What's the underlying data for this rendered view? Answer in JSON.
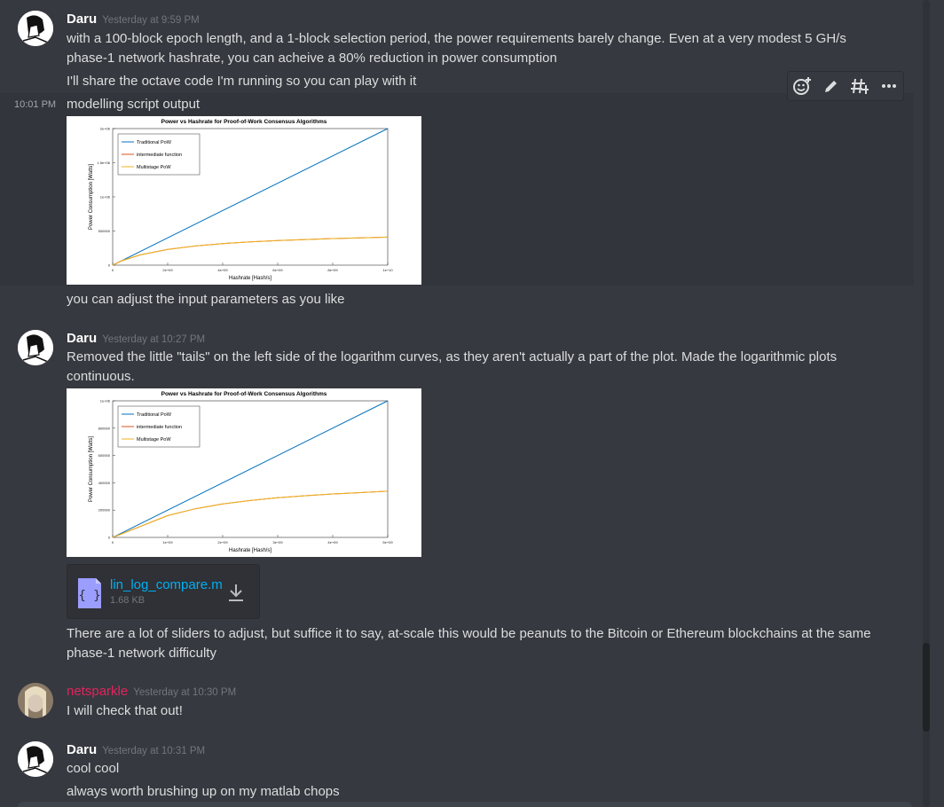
{
  "messages": [
    {
      "author": "Daru",
      "timestamp": "Yesterday at 9:59 PM",
      "lines": [
        "with a 100-block epoch length, and a 1-block selection period, the power requirements barely change. Even at a very modest 5 GH/s",
        "phase-1 network hashrate, you can acheive a 80% reduction in power consumption",
        "I'll share the octave code I'm running so you can play with it"
      ]
    },
    {
      "side_timestamp": "10:01 PM",
      "lines": [
        "modelling script output",
        "you can adjust the input parameters as you like"
      ]
    },
    {
      "author": "Daru",
      "timestamp": "Yesterday at 10:27 PM",
      "lines": [
        "Removed the little \"tails\" on the left side of the logarithm curves, as they aren't actually a part of the plot. Made the logarithmic plots",
        "continuous.",
        "There are a lot of sliders to adjust, but suffice it to say, at-scale this would be peanuts to the Bitcoin or Ethereum blockchains at the same",
        "phase-1 network difficulty"
      ],
      "attachment": {
        "name": "lin_log_compare.m",
        "size": "1.68 KB",
        "icon": "code-file-icon"
      }
    },
    {
      "author": "netsparkle",
      "timestamp": "Yesterday at 10:30 PM",
      "author_color": "#e0245e",
      "lines": [
        "I will check that out!"
      ]
    },
    {
      "author": "Daru",
      "timestamp": "Yesterday at 10:31 PM",
      "lines": [
        "cool cool",
        "always worth brushing up on my matlab chops"
      ]
    }
  ],
  "toolbar": {
    "icons": [
      "add-reaction-icon",
      "edit-icon",
      "create-thread-icon",
      "more-icon"
    ]
  },
  "chart_data": [
    {
      "type": "line",
      "title": "Power vs Hashrate for Proof-of-Work Consensus Algorithms",
      "xlabel": "Hashrate [Hash/s]",
      "ylabel": "Power Consumption [Watts]",
      "xticks": [
        "0",
        "2e+09",
        "4e+09",
        "6e+09",
        "8e+09",
        "1e+10"
      ],
      "yticks": [
        "0",
        "500000",
        "1e+06",
        "1.5e+06",
        "2e+06"
      ],
      "xlim": [
        0,
        10000000000
      ],
      "ylim": [
        0,
        2000000
      ],
      "legend": "top-left",
      "series": [
        {
          "name": "Traditional PoW",
          "color": "#0072bd",
          "x": [
            0,
            10000000000
          ],
          "y": [
            0,
            2000000
          ]
        },
        {
          "name": "intermediate function",
          "color": "#d95319",
          "x": [
            0,
            300000000,
            1000000000,
            2000000000,
            3000000000,
            4000000000,
            5000000000,
            6000000000,
            7000000000,
            8000000000,
            9000000000,
            10000000000
          ],
          "y": [
            0,
            60000,
            150000,
            230000,
            280000,
            315000,
            340000,
            360000,
            375000,
            390000,
            400000,
            410000
          ]
        },
        {
          "name": "Multistage PoW",
          "color": "#edb120",
          "x": [
            0,
            300000000,
            1000000000,
            2000000000,
            3000000000,
            4000000000,
            5000000000,
            6000000000,
            7000000000,
            8000000000,
            9000000000,
            10000000000
          ],
          "y": [
            0,
            60000,
            150000,
            230000,
            280000,
            315000,
            340000,
            360000,
            375000,
            390000,
            400000,
            410000
          ]
        }
      ]
    },
    {
      "type": "line",
      "title": "Power vs Hashrate for Proof-of-Work Consensus Algorithms",
      "xlabel": "Hashrate [Hash/s]",
      "ylabel": "Power Consumption [Watts]",
      "xticks": [
        "0",
        "1e+09",
        "2e+09",
        "3e+09",
        "4e+09",
        "5e+09"
      ],
      "yticks": [
        "0",
        "200000",
        "400000",
        "600000",
        "800000",
        "1e+06"
      ],
      "xlim": [
        0,
        5000000000
      ],
      "ylim": [
        0,
        1000000
      ],
      "legend": "top-left",
      "series": [
        {
          "name": "Traditional PoW",
          "color": "#0072bd",
          "x": [
            0,
            5000000000
          ],
          "y": [
            0,
            1000000
          ]
        },
        {
          "name": "intermediate function",
          "color": "#d95319",
          "x": [
            0,
            1000000000,
            1500000000,
            2000000000,
            2500000000,
            3000000000,
            3500000000,
            4000000000,
            4500000000,
            5000000000
          ],
          "y": [
            0,
            160000,
            210000,
            245000,
            270000,
            290000,
            305000,
            318000,
            328000,
            338000
          ]
        },
        {
          "name": "Multistage PoW",
          "color": "#edb120",
          "x": [
            0,
            1000000000,
            1500000000,
            2000000000,
            2500000000,
            3000000000,
            3500000000,
            4000000000,
            4500000000,
            5000000000
          ],
          "y": [
            0,
            160000,
            210000,
            245000,
            270000,
            290000,
            305000,
            318000,
            328000,
            338000
          ]
        }
      ]
    }
  ]
}
